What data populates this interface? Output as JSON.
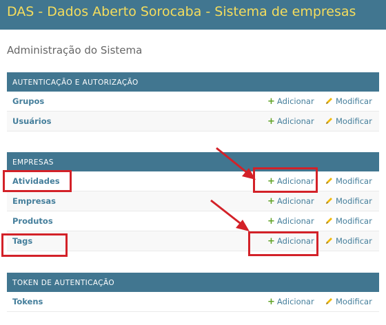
{
  "header": {
    "title": "DAS - Dados Aberto Sorocaba - Sistema de empresas"
  },
  "page": {
    "title": "Administração do Sistema"
  },
  "modules": [
    {
      "caption": "AUTENTICAÇÃO E AUTORIZAÇÃO",
      "models": [
        {
          "name": "Grupos",
          "add": "Adicionar",
          "change": "Modificar"
        },
        {
          "name": "Usuários",
          "add": "Adicionar",
          "change": "Modificar"
        }
      ]
    },
    {
      "caption": "EMPRESAS",
      "models": [
        {
          "name": "Atividades",
          "add": "Adicionar",
          "change": "Modificar"
        },
        {
          "name": "Empresas",
          "add": "Adicionar",
          "change": "Modificar"
        },
        {
          "name": "Produtos",
          "add": "Adicionar",
          "change": "Modificar"
        },
        {
          "name": "Tags",
          "add": "Adicionar",
          "change": "Modificar"
        }
      ]
    },
    {
      "caption": "TOKEN DE AUTENTICAÇÃO",
      "models": [
        {
          "name": "Tokens",
          "add": "Adicionar",
          "change": "Modificar"
        }
      ]
    }
  ],
  "icons": {
    "add": "plus-icon",
    "change": "pencil-icon"
  },
  "colors": {
    "header_bg": "#417690",
    "title": "#f5dd5d",
    "link": "#447e9b",
    "add_icon": "#5fa225",
    "annotation": "#d32128"
  }
}
